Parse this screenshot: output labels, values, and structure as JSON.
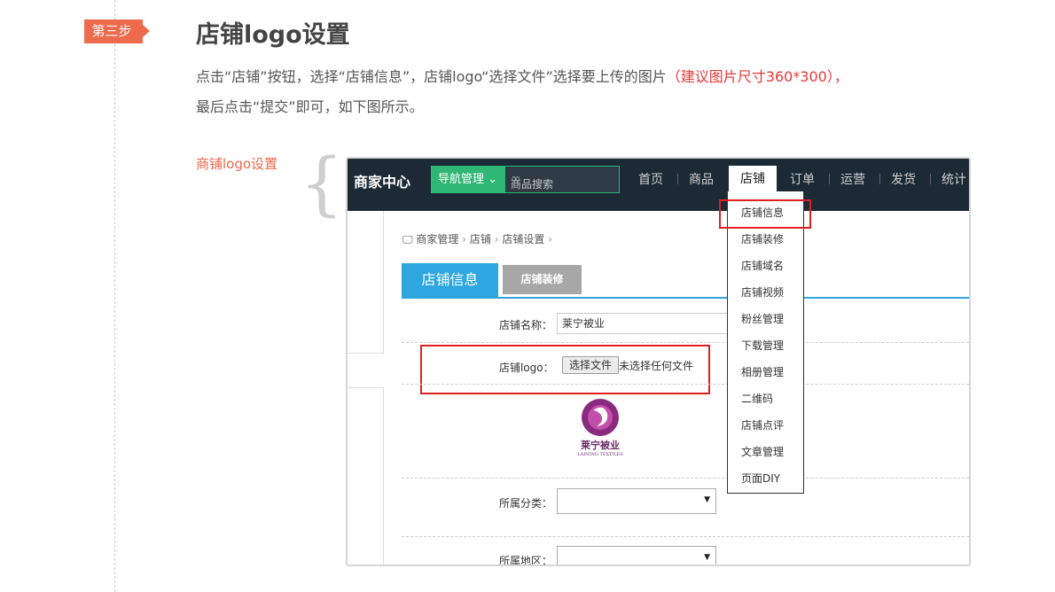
{
  "step": {
    "badge": "第三步",
    "title": "店铺logo设置"
  },
  "description": {
    "line1_pre": "点击“店铺”按钮，选择“店铺信息”，店铺logo“选择文件”选择要上传的图片",
    "line1_highlight": "（建议图片尺寸360*300），",
    "line2": "最后点击“提交”即可，如下图所示。",
    "highlight_color": "#e53935"
  },
  "side_label": "商铺logo设置",
  "screenshot": {
    "brand": "商家中心",
    "nav_button": "导航管理",
    "search_placeholder": "商品搜索",
    "menu": [
      "首页",
      "商品",
      "店铺",
      "订单",
      "运营",
      "发货",
      "统计"
    ],
    "active_menu": "店铺",
    "breadcrumb": [
      "商家管理",
      "店铺",
      "店铺设置"
    ],
    "tabs": [
      "店铺信息",
      "店铺装修"
    ],
    "form": {
      "shop_name_label": "店铺名称：",
      "shop_name_value": "莱宁被业",
      "logo_label": "店铺logo：",
      "file_button": "选择文件",
      "file_status": "未选择任何文件",
      "logo_text": "莱宁被业",
      "logo_subtext": "LAINING TEXTILES",
      "category_label": "所属分类：",
      "region_label": "所属地区："
    },
    "dropdown": [
      "店铺信息",
      "店铺装修",
      "店铺域名",
      "店铺视频",
      "粉丝管理",
      "下载管理",
      "相册管理",
      "二维码",
      "店铺点评",
      "文章管理",
      "页面DIY"
    ]
  },
  "colors": {
    "accent": "#ee6a4c",
    "nav_green": "#2db674",
    "tab_blue": "#2ea6df",
    "topbar": "#1c2a35"
  }
}
